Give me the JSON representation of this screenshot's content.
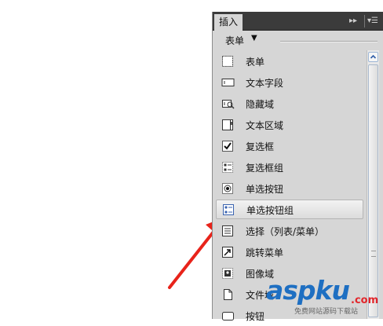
{
  "panel": {
    "tab_label": "插入",
    "category": "表单",
    "items": [
      {
        "label": "表单",
        "icon": "form-icon"
      },
      {
        "label": "文本字段",
        "icon": "text-field-icon"
      },
      {
        "label": "隐藏域",
        "icon": "hidden-field-icon"
      },
      {
        "label": "文本区域",
        "icon": "textarea-icon"
      },
      {
        "label": "复选框",
        "icon": "checkbox-icon"
      },
      {
        "label": "复选框组",
        "icon": "checkbox-group-icon"
      },
      {
        "label": "单选按钮",
        "icon": "radio-button-icon"
      },
      {
        "label": "单选按钮组",
        "icon": "radio-group-icon",
        "selected": true
      },
      {
        "label": "选择（列表/菜单）",
        "icon": "select-list-icon"
      },
      {
        "label": "跳转菜单",
        "icon": "jump-menu-icon"
      },
      {
        "label": "图像域",
        "icon": "image-field-icon"
      },
      {
        "label": "文件域",
        "icon": "file-field-icon"
      },
      {
        "label": "按钮",
        "icon": "button-icon"
      }
    ]
  },
  "watermark": {
    "main": "aspku",
    "suffix": ".com",
    "sub": "免费网站源码下载站"
  },
  "colors": {
    "arrow": "#e8231a",
    "watermark_blue": "#1e6fc2",
    "watermark_red": "#e2262b"
  }
}
